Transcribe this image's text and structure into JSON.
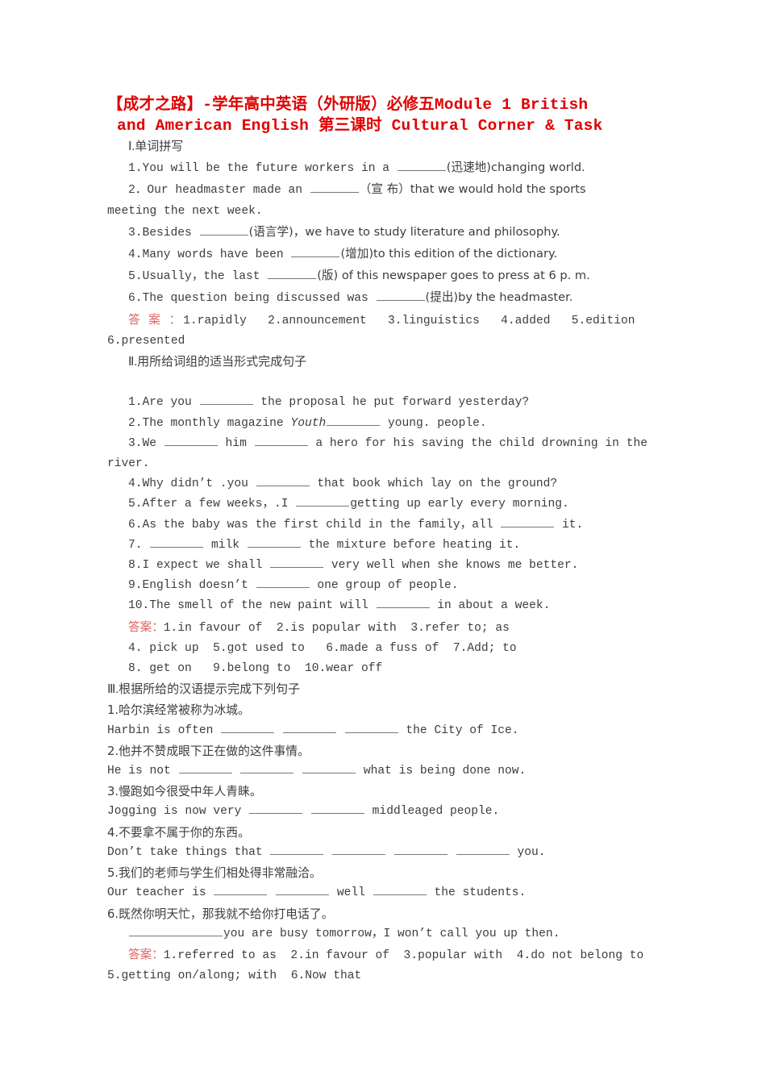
{
  "title": {
    "line1": "【成才之路】-学年高中英语（外研版）必修五Module 1  British",
    "line2": "and American English 第三课时  Cultural Corner & Task",
    "color": "#e00000"
  },
  "answer_label": "答案：",
  "answer_label_spaced": "答 案 ：",
  "answer_color": "#e0655f",
  "sections": [
    {
      "numeral": "Ⅰ.",
      "heading_cn": "单词拼写",
      "questions": [
        {
          "num": "1.",
          "pre": "You will be the future workers in a ",
          "blank": "md",
          "post": "(迅速地)changing world."
        },
        {
          "num": "2．",
          "pre": "Our headmaster made an ",
          "blank": "md",
          "post": "（宣 布）that we would hold the sports",
          "wrap": "meeting the next week."
        },
        {
          "num": "3.",
          "pre": "Besides ",
          "blank": "md",
          "post": "(语言学)，we have to study literature and philosophy."
        },
        {
          "num": "4.",
          "pre": "Many words have been ",
          "blank": "md",
          "post": "(增加)to this edition of the dictionary."
        },
        {
          "num": "5.",
          "pre": "Usually，the last ",
          "blank": "md",
          "post": "(版) of this newspaper goes to press at 6 p. m."
        },
        {
          "num": "6.",
          "pre": "The question being discussed was ",
          "blank": "md",
          "post": "(提出)by the headmaster."
        }
      ],
      "answers_line1": "1.rapidly   2.announcement   3.linguistics   4.added   5.edition",
      "answers_line2": "6.presented"
    },
    {
      "numeral": "Ⅱ.",
      "heading_cn": "用所给词组的适当形式完成句子",
      "questions": [
        {
          "num": "1.",
          "pre": "Are you ",
          "blank": "lg",
          "post": " the proposal he put forward yesterday?"
        },
        {
          "num": "2.",
          "pre": "The monthly magazine ",
          "italic": "Youth",
          "blank": "lg",
          "post": " young. people."
        },
        {
          "num": "3.",
          "pre": "We ",
          "blank": "lg",
          "mid": " him ",
          "blank2": "lg",
          "post": " a hero for his saving the child drowning in the",
          "wrap": "river."
        },
        {
          "num": "4.",
          "pre": "Why didn’t .you ",
          "blank": "lg",
          "post": " that book which lay on the ground?"
        },
        {
          "num": "5.",
          "pre": "After a few weeks，.I ",
          "blank": "lg",
          "post": "getting up early every morning."
        },
        {
          "num": "6.",
          "pre": "As the baby was the first child in the family，all ",
          "blank": "lg",
          "post": " it."
        },
        {
          "num": "7.",
          "pre": " ",
          "blank": "lg",
          "mid": " milk ",
          "blank2": "lg",
          "post": " the mixture before heating it."
        },
        {
          "num": "8.",
          "pre": "I expect we shall ",
          "blank": "lg",
          "post": " very well when she knows me better."
        },
        {
          "num": "9.",
          "pre": "English doesn’t ",
          "blank": "lg",
          "post": " one group of people."
        },
        {
          "num": "10.",
          "pre": "The smell of the new paint will ",
          "blank": "lg",
          "post": " in about a week."
        }
      ],
      "answers_line1": "1.in favour of  2.is popular with  3.refer to; as",
      "answers_line2": "4. pick up  5.got used to   6.made a fuss of  7.Add; to",
      "answers_line3": "8. get on   9.belong to  10.wear off"
    },
    {
      "numeral": "Ⅲ.",
      "heading_cn": "根据所给的汉语提示完成下列句子",
      "pairs": [
        {
          "num": "1.",
          "cn": "哈尔滨经常被称为冰城。",
          "en_pre": "Harbin is often ",
          "en_post": " the City of Ice.",
          "blanks": 3
        },
        {
          "num": "2.",
          "cn": "他并不赞成眼下正在做的这件事情。",
          "en_pre": "He is not ",
          "en_post": " what is being done now.",
          "blanks": 3
        },
        {
          "num": "3.",
          "cn": "慢跑如今很受中年人青睐。",
          "en_pre": "Jogging is now very ",
          "en_post": " middleaged people.",
          "blanks": 2
        },
        {
          "num": "4.",
          "cn": "不要拿不属于你的东西。",
          "en_pre": "Don’t take things that ",
          "en_post": " you.",
          "blanks": 4
        },
        {
          "num": "5.",
          "cn": "我们的老师与学生们相处得非常融洽。",
          "en_pre": "Our teacher is ",
          "en_mid": " well ",
          "en_post": " the students.",
          "blanks": 2,
          "blanks_after": 1
        },
        {
          "num": "6.",
          "cn": "既然你明天忙，那我就不给你打电话了。",
          "en_pre": "",
          "en_post": "you are busy tomorrow，I won’t call you up then.",
          "blanks": 1,
          "blank_size": "xxl"
        }
      ],
      "answers_line1": "1.referred to as  2.in favour of  3.popular with  4.do not belong to",
      "answers_line2": "5.getting on/along; with  6.Now that"
    }
  ]
}
